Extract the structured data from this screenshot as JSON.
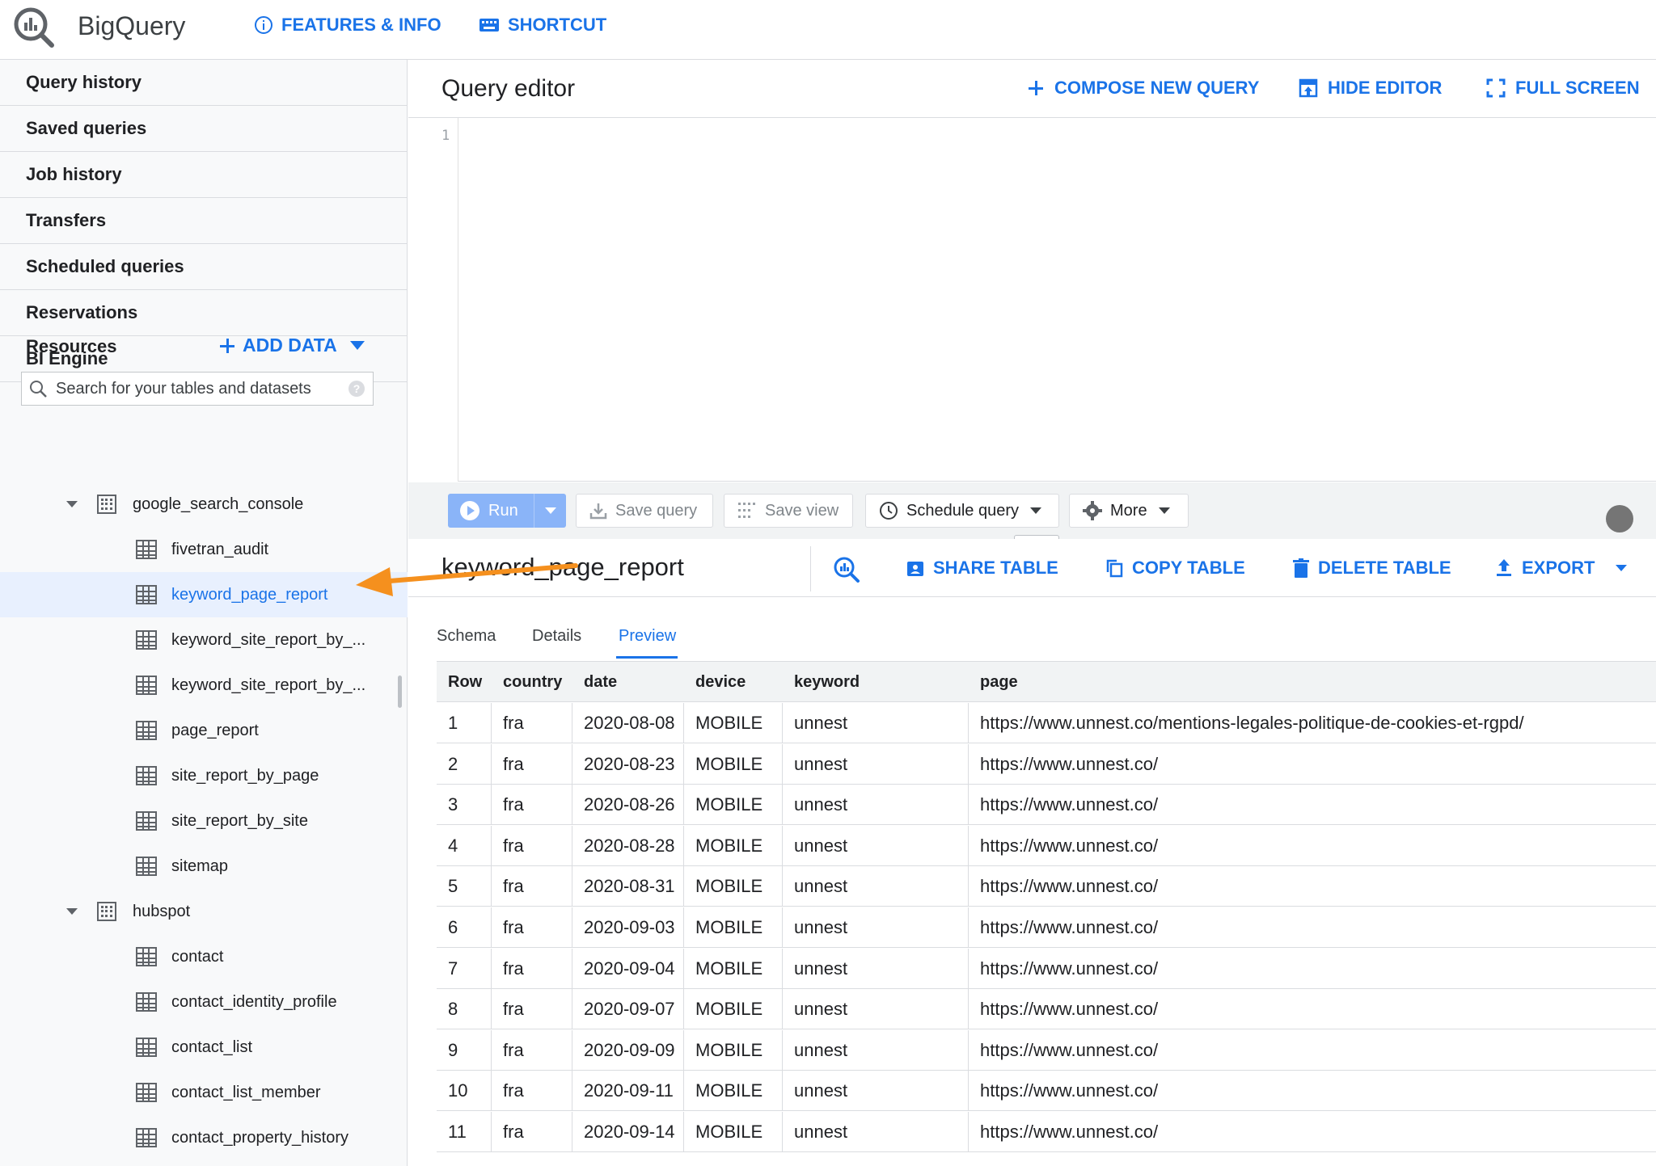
{
  "app": {
    "title": "BigQuery"
  },
  "topnav": {
    "features": "FEATURES & INFO",
    "shortcut": "SHORTCUT"
  },
  "sidebar": {
    "items": [
      {
        "label": "Query history"
      },
      {
        "label": "Saved queries"
      },
      {
        "label": "Job history"
      },
      {
        "label": "Transfers"
      },
      {
        "label": "Scheduled queries"
      },
      {
        "label": "Reservations"
      },
      {
        "label": "BI Engine"
      }
    ],
    "resources_label": "Resources",
    "add_data": "ADD DATA",
    "search_placeholder": "Search for your tables and datasets",
    "datasets": [
      {
        "name": "google_search_console",
        "tables": [
          "fivetran_audit",
          "keyword_page_report",
          "keyword_site_report_by_...",
          "keyword_site_report_by_...",
          "page_report",
          "site_report_by_page",
          "site_report_by_site",
          "sitemap"
        ]
      },
      {
        "name": "hubspot",
        "tables": [
          "contact",
          "contact_identity_profile",
          "contact_list",
          "contact_list_member",
          "contact_property_history"
        ]
      }
    ],
    "selected_table": "keyword_page_report"
  },
  "editor": {
    "title": "Query editor",
    "compose": "COMPOSE NEW QUERY",
    "hide": "HIDE EDITOR",
    "fullscreen": "FULL SCREEN",
    "line_number": "1"
  },
  "toolbar": {
    "run": "Run",
    "save_query": "Save query",
    "save_view": "Save view",
    "schedule_query": "Schedule query",
    "more": "More"
  },
  "table_view": {
    "title": "keyword_page_report",
    "share": "SHARE TABLE",
    "copy": "COPY TABLE",
    "delete": "DELETE TABLE",
    "export": "EXPORT",
    "tabs": [
      "Schema",
      "Details",
      "Preview"
    ],
    "active_tab": "Preview",
    "columns": [
      "Row",
      "country",
      "date",
      "device",
      "keyword",
      "page"
    ],
    "rows": [
      [
        "1",
        "fra",
        "2020-08-08",
        "MOBILE",
        "unnest",
        "https://www.unnest.co/mentions-legales-politique-de-cookies-et-rgpd/"
      ],
      [
        "2",
        "fra",
        "2020-08-23",
        "MOBILE",
        "unnest",
        "https://www.unnest.co/"
      ],
      [
        "3",
        "fra",
        "2020-08-26",
        "MOBILE",
        "unnest",
        "https://www.unnest.co/"
      ],
      [
        "4",
        "fra",
        "2020-08-28",
        "MOBILE",
        "unnest",
        "https://www.unnest.co/"
      ],
      [
        "5",
        "fra",
        "2020-08-31",
        "MOBILE",
        "unnest",
        "https://www.unnest.co/"
      ],
      [
        "6",
        "fra",
        "2020-09-03",
        "MOBILE",
        "unnest",
        "https://www.unnest.co/"
      ],
      [
        "7",
        "fra",
        "2020-09-04",
        "MOBILE",
        "unnest",
        "https://www.unnest.co/"
      ],
      [
        "8",
        "fra",
        "2020-09-07",
        "MOBILE",
        "unnest",
        "https://www.unnest.co/"
      ],
      [
        "9",
        "fra",
        "2020-09-09",
        "MOBILE",
        "unnest",
        "https://www.unnest.co/"
      ],
      [
        "10",
        "fra",
        "2020-09-11",
        "MOBILE",
        "unnest",
        "https://www.unnest.co/"
      ],
      [
        "11",
        "fra",
        "2020-09-14",
        "MOBILE",
        "unnest",
        "https://www.unnest.co/"
      ]
    ]
  },
  "colors": {
    "accent": "#1a73e8",
    "selected_bg": "#e8f0fe",
    "annotation_arrow": "#f5901e",
    "run_button": "#8ab4f8"
  }
}
